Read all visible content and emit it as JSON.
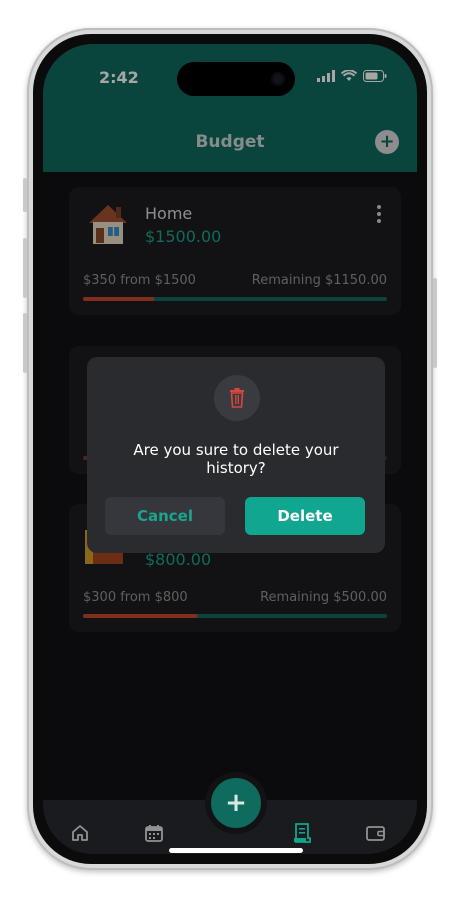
{
  "status_bar": {
    "time": "2:42"
  },
  "header": {
    "title": "Budget"
  },
  "cards": [
    {
      "name": "Home",
      "amount": "$1500.00",
      "spent": "$350 from $1500",
      "remaining": "Remaining $1150.00",
      "progress": 0.233
    },
    {
      "name": "",
      "amount": "",
      "spent": "",
      "remaining": "",
      "progress": 0.1
    },
    {
      "name": "",
      "amount": "$800.00",
      "spent": "$300 from $800",
      "remaining": "Remaining $500.00",
      "progress": 0.375
    }
  ],
  "dialog": {
    "message": "Are you sure to delete your history?",
    "cancel_label": "Cancel",
    "delete_label": "Delete"
  },
  "tabs": [
    "home-icon",
    "calendar-icon",
    "add-icon",
    "receipt-icon",
    "wallet-icon"
  ],
  "colors": {
    "accent": "#0f6b5e",
    "danger": "#c7472a",
    "dialog_bg": "#2a2b2f"
  }
}
